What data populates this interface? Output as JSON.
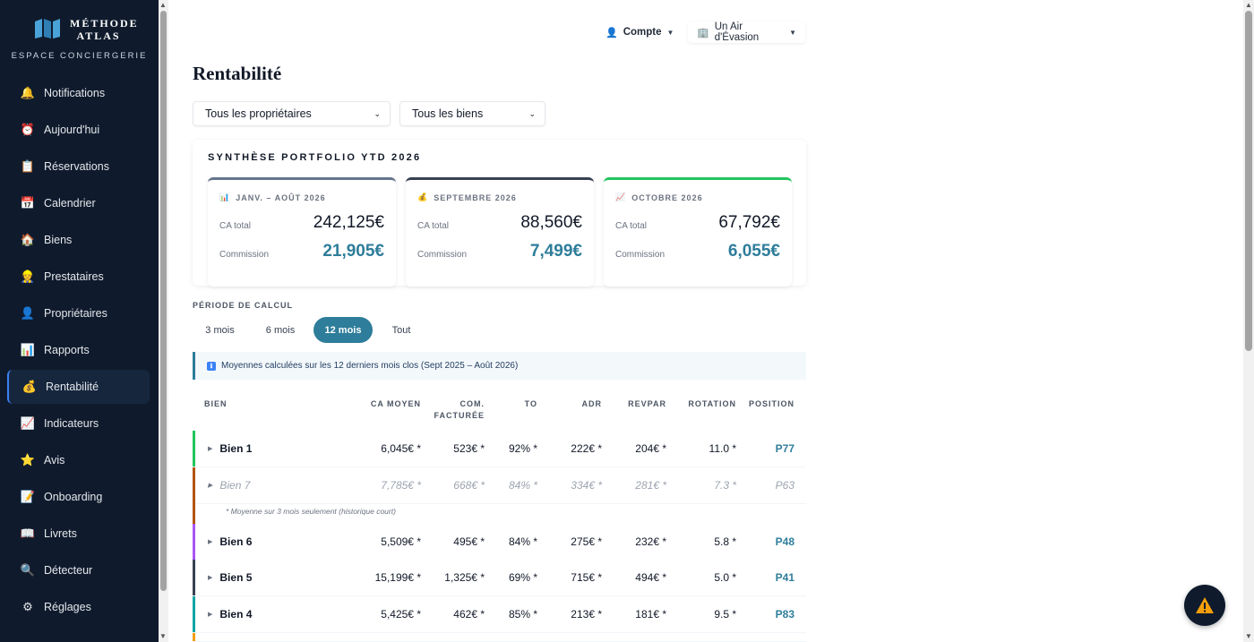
{
  "brand": {
    "name_line1": "MÉTHODE",
    "name_line2": "ATLAS",
    "subtitle": "ESPACE CONCIERGERIE"
  },
  "nav": [
    {
      "label": "Notifications",
      "icon": "bell-icon",
      "glyph": "🔔"
    },
    {
      "label": "Aujourd'hui",
      "icon": "alarm-clock-icon",
      "glyph": "⏰"
    },
    {
      "label": "Réservations",
      "icon": "clipboard-icon",
      "glyph": "📋"
    },
    {
      "label": "Calendrier",
      "icon": "calendar-icon",
      "glyph": "📅"
    },
    {
      "label": "Biens",
      "icon": "house-icon",
      "glyph": "🏠"
    },
    {
      "label": "Prestataires",
      "icon": "worker-icon",
      "glyph": "👷"
    },
    {
      "label": "Propriétaires",
      "icon": "user-icon",
      "glyph": "👤"
    },
    {
      "label": "Rapports",
      "icon": "bar-chart-icon",
      "glyph": "📊"
    },
    {
      "label": "Rentabilité",
      "icon": "money-bag-icon",
      "glyph": "💰",
      "active": true
    },
    {
      "label": "Indicateurs",
      "icon": "trend-chart-icon",
      "glyph": "📈"
    },
    {
      "label": "Avis",
      "icon": "star-icon",
      "glyph": "⭐"
    },
    {
      "label": "Onboarding",
      "icon": "checklist-icon",
      "glyph": "📝"
    },
    {
      "label": "Livrets",
      "icon": "book-icon",
      "glyph": "📖"
    },
    {
      "label": "Détecteur",
      "icon": "magnifier-icon",
      "glyph": "🔍"
    },
    {
      "label": "Réglages",
      "icon": "gear-icon",
      "glyph": "⚙"
    }
  ],
  "topbar": {
    "account_label": "Compte",
    "property_label": "Un Air d'Évasion"
  },
  "page": {
    "title": "Rentabilité"
  },
  "filters": {
    "owner": "Tous les propriétaires",
    "property": "Tous les biens"
  },
  "synthese": {
    "title": "SYNTHÈSE PORTFOLIO YTD 2026",
    "cards": [
      {
        "period": "JANV. – AOÛT 2026",
        "icon": "bar-chart-icon",
        "glyph": "📊",
        "ca_label": "CA total",
        "ca_value": "242,125€",
        "com_label": "Commission",
        "com_value": "21,905€",
        "accent": "#64748b"
      },
      {
        "period": "SEPTEMBRE 2026",
        "icon": "money-bag-icon",
        "glyph": "💰",
        "ca_label": "CA total",
        "ca_value": "88,560€",
        "com_label": "Commission",
        "com_value": "7,499€",
        "accent": "#374151"
      },
      {
        "period": "OCTOBRE 2026",
        "icon": "trend-chart-icon",
        "glyph": "📈",
        "ca_label": "CA total",
        "ca_value": "67,792€",
        "com_label": "Commission",
        "com_value": "6,055€",
        "accent": "#22c55e"
      }
    ]
  },
  "period": {
    "label": "PÉRIODE DE CALCUL",
    "options": [
      "3 mois",
      "6 mois",
      "12 mois",
      "Tout"
    ],
    "selected": "12 mois"
  },
  "info": {
    "icon": "info-icon",
    "glyph": "ℹ",
    "text": "Moyennes calculées sur les 12 derniers mois clos (Sept 2025 – Août 2026)"
  },
  "table": {
    "headers": {
      "bien": "BIEN",
      "ca": "CA MOYEN",
      "com1": "COM.",
      "com2": "FACTURÉE",
      "to": "TO",
      "adr": "ADR",
      "revpar": "REVPAR",
      "rotation": "ROTATION",
      "position": "POSITION"
    },
    "rows": [
      {
        "name": "Bien 1",
        "ca": "6,045€ *",
        "com": "523€ *",
        "to": "92% *",
        "adr": "222€ *",
        "revpar": "204€ *",
        "rotation": "11.0 *",
        "position": "P77",
        "color": "#22c55e"
      },
      {
        "name": "Bien 7",
        "ca": "7,785€ *",
        "com": "668€ *",
        "to": "84% *",
        "adr": "334€ *",
        "revpar": "281€ *",
        "rotation": "7.3 *",
        "position": "P63",
        "color": "#b45309",
        "dim": true
      },
      {
        "name": "Bien 6",
        "ca": "5,509€ *",
        "com": "495€ *",
        "to": "84% *",
        "adr": "275€ *",
        "revpar": "232€ *",
        "rotation": "5.8 *",
        "position": "P48",
        "color": "#a855f7"
      },
      {
        "name": "Bien 5",
        "ca": "15,199€ *",
        "com": "1,325€ *",
        "to": "69% *",
        "adr": "715€ *",
        "revpar": "494€ *",
        "rotation": "5.0 *",
        "position": "P41",
        "color": "#374151"
      },
      {
        "name": "Bien 4",
        "ca": "5,425€ *",
        "com": "462€ *",
        "to": "85% *",
        "adr": "213€ *",
        "revpar": "181€ *",
        "rotation": "9.5 *",
        "position": "P83",
        "color": "#0ea5a4"
      }
    ],
    "note": "* Moyenne sur 3 mois seulement (historique court)"
  },
  "fab": {
    "icon": "warning-icon",
    "glyph": "⚠"
  }
}
